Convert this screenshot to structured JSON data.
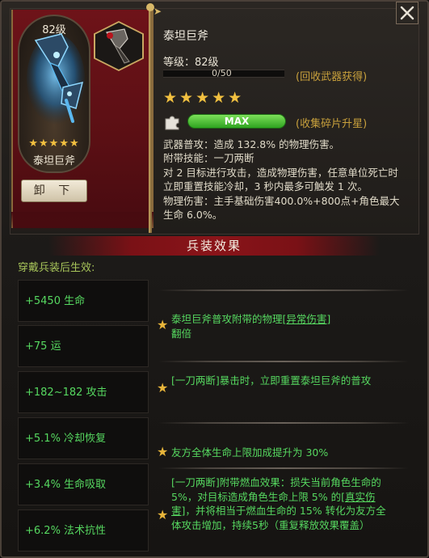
{
  "weapon": {
    "level_badge": "82级",
    "name": "泰坦巨斧",
    "stars": "★★★★★",
    "unequip_label": "卸 下"
  },
  "info": {
    "title": "泰坦巨斧",
    "level_label": "等级：82级",
    "exp_text": "0/50",
    "exp_progress": 0,
    "recycle_hint": "(回收武器获得)",
    "star_rating": 5,
    "stars_display": "★★★★★",
    "max_label": "MAX",
    "collect_hint": "(收集碎片升星)",
    "description": "武器普攻：造成 132.8% 的物理伤害。\n附带技能：一刀两断\n对 2 目标进行攻击，造成物理伤害，任意单位死亡时立即重置技能冷却，3 秒内最多可触发 1 次。\n物理伤害：主手基础伤害400.0%+800点+角色最大生命 6.0%。"
  },
  "effects_panel": {
    "header": "兵装效果",
    "equip_label": "穿戴兵装后生效:",
    "stats": [
      "+5450 生命",
      "+75 运",
      "+182~182 攻击",
      "+5.1% 冷却恢复",
      "+3.4% 生命吸取",
      "+6.2% 法术抗性"
    ],
    "effect1": {
      "a": "泰坦巨斧普攻附带的物理",
      "b": "[异常伤害]",
      "c": "翻倍"
    },
    "effect2": "[一刀两断]暴击时，立即重置泰坦巨斧的普攻",
    "effect3": "友方全体生命上限加成提升为 30%",
    "effect4": {
      "a": "[一刀两断]附带燃血效果：损失当前角色生命的5%，对目标造成角色生命上限 5% 的",
      "b": "[真实伤害]",
      "c": "，并将相当于燃血生命的 15% 转化为友方全体攻击增加，持续5秒（重复释放效果覆盖）"
    }
  },
  "colors": {
    "banner_red": "#6e1319",
    "stat_green": "#56d860",
    "hint_gold": "#c9a13c",
    "star_gold": "#f2c040"
  },
  "icons": [
    "close-icon",
    "axe-icon",
    "puzzle-icon",
    "star-icon"
  ]
}
